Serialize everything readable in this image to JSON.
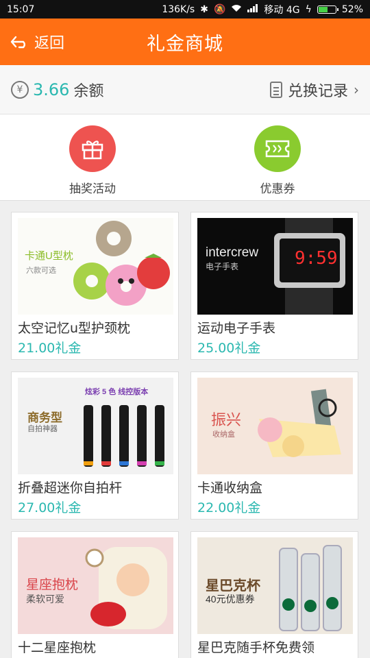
{
  "status": {
    "time": "15:07",
    "speed": "136K/s",
    "carrier": "移动 4G",
    "battery": "52%",
    "battery_level": 0.52
  },
  "nav": {
    "back_label": "返回",
    "title": "礼金商城"
  },
  "balance": {
    "currency_icon": "yen-icon",
    "amount": "3.66",
    "label": "余额",
    "records_label": "兑换记录"
  },
  "quick_actions": [
    {
      "label": "抽奖活动",
      "icon": "gift-icon",
      "color": "#ee5350"
    },
    {
      "label": "优惠券",
      "icon": "ticket-icon",
      "color": "#8acb2f"
    }
  ],
  "products": [
    {
      "name": "太空记忆u型护颈枕",
      "price": "21.00礼金",
      "img_title": "卡通U型枕",
      "img_sub": "六款可选"
    },
    {
      "name": "运动电子手表",
      "price": "25.00礼金",
      "img_title": "intercrew",
      "img_sub": "电子手表",
      "img_digits": "9:59"
    },
    {
      "name": "折叠超迷你自拍杆",
      "price": "27.00礼金",
      "img_title": "商务型",
      "img_sub": "自拍神器",
      "img_banner": "炫彩 5 色  线控版本"
    },
    {
      "name": "卡通收纳盒",
      "price": "22.00礼金",
      "img_title": "振兴",
      "img_sub": "收纳盒"
    },
    {
      "name": "十二星座抱枕",
      "price": "",
      "img_title": "星座抱枕",
      "img_sub": "柔软可爱"
    },
    {
      "name": "星巴克随手杯免费领",
      "price": "",
      "img_title": "星巴克杯",
      "img_sub": "40元优惠券"
    }
  ],
  "colors": {
    "brand": "#ff6f14",
    "accent": "#2bb8b0"
  }
}
